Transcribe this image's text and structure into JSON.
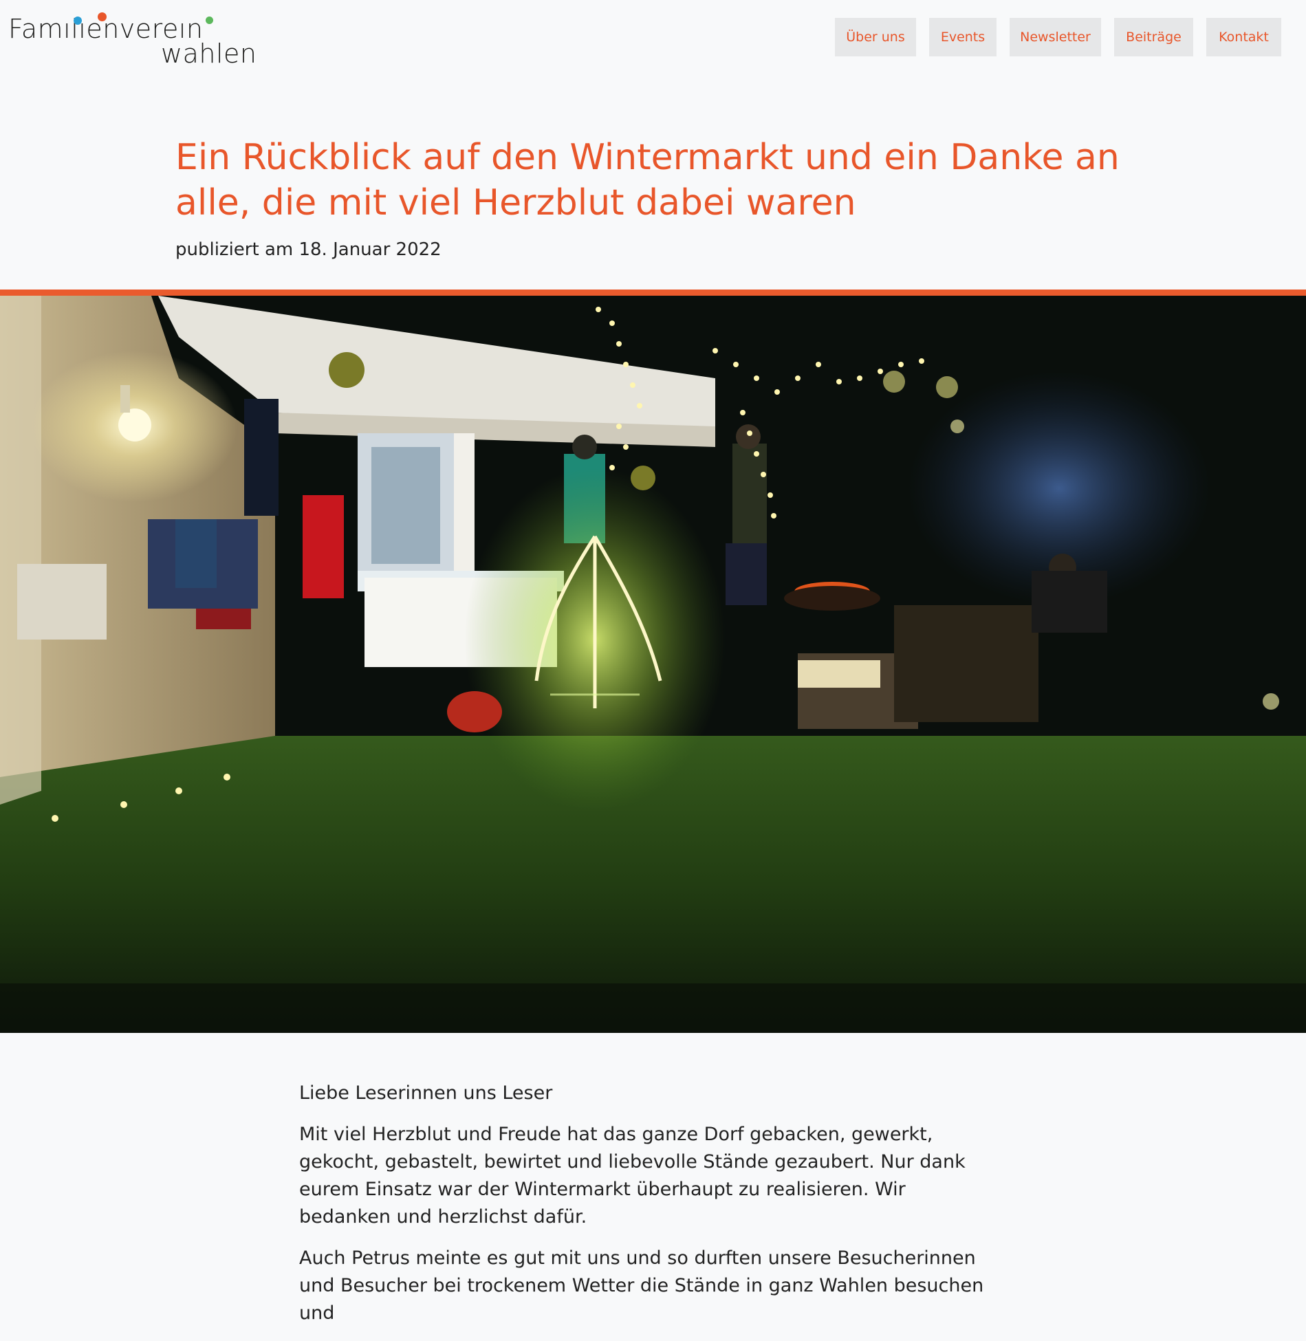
{
  "logo": {
    "line1": "Famılıenvereın",
    "line2": "wahlen"
  },
  "nav": {
    "items": [
      {
        "label": "Über uns"
      },
      {
        "label": "Events"
      },
      {
        "label": "Newsletter"
      },
      {
        "label": "Beiträge"
      },
      {
        "label": "Kontakt"
      }
    ]
  },
  "article": {
    "title": "Ein Rückblick auf den Wintermarkt und ein Danke an alle, die mit viel Herzblut dabei waren",
    "published": "publiziert am 18. Januar 2022",
    "paragraphs": [
      "Liebe Leserinnen uns Leser",
      "Mit viel Herzblut und Freude hat das ganze Dorf gebacken, gewerkt, gekocht, gebastelt, bewirtet und liebevolle Stände gezaubert. Nur dank eurem Einsatz war der Wintermarkt überhaupt zu realisieren. Wir bedanken und herzlichst dafür.",
      "Auch Petrus meinte es gut mit uns und so durften unsere Besucherinnen und Besucher bei trockenem Wetter die Stände in ganz Wahlen besuchen und"
    ]
  },
  "colors": {
    "accent": "#e8562a",
    "nav_bg": "#e6e7e8",
    "page_bg": "#f8f9fa",
    "logo_dot_blue": "#2a9fd6",
    "logo_dot_orange": "#e8562a",
    "logo_dot_green": "#5cb85c"
  }
}
